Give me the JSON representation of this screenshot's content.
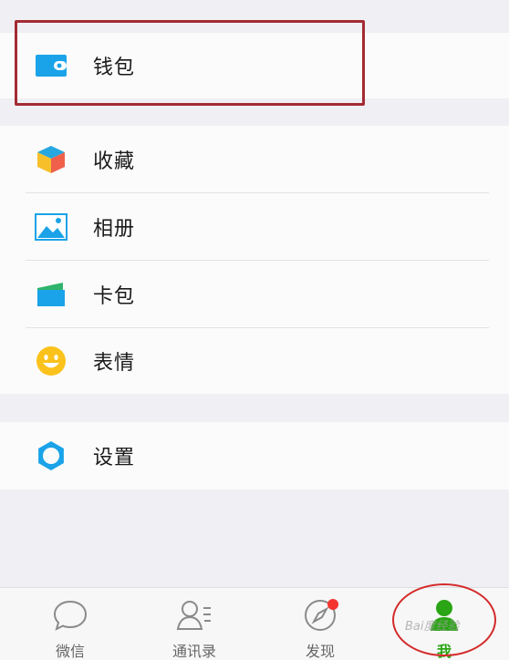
{
  "menu": {
    "wallet": {
      "label": "钱包",
      "icon": "wallet-icon"
    },
    "items": [
      {
        "label": "收藏",
        "icon": "favorites-cube-icon"
      },
      {
        "label": "相册",
        "icon": "album-picture-icon"
      },
      {
        "label": "卡包",
        "icon": "card-wallet-icon"
      },
      {
        "label": "表情",
        "icon": "emoji-smile-icon"
      }
    ],
    "settings": {
      "label": "设置",
      "icon": "gear-icon"
    }
  },
  "tabbar": {
    "tabs": [
      {
        "label": "微信",
        "icon": "chat-bubble-icon",
        "active": false
      },
      {
        "label": "通讯录",
        "icon": "contacts-icon",
        "active": false
      },
      {
        "label": "发现",
        "icon": "compass-icon",
        "active": false,
        "badge_dot": true
      },
      {
        "label": "我",
        "icon": "profile-person-icon",
        "active": true
      }
    ]
  },
  "watermark": "Bai度经验",
  "colors": {
    "accent_green": "#2aa515",
    "highlight_red": "#a42b33",
    "badge_red": "#f43530",
    "icon_blue": "#1aa3e8"
  }
}
